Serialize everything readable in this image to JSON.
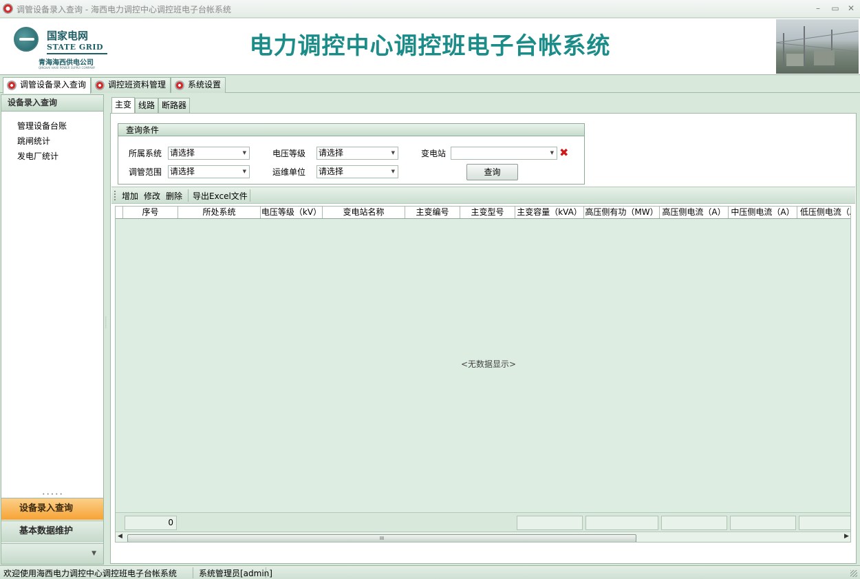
{
  "window": {
    "title": "调管设备录入查询 - 海西电力调控中心调控班电子台帐系统",
    "minimize": "–",
    "maximize": "▭",
    "close": "✕"
  },
  "header": {
    "logo_cn": "国家电网",
    "logo_en": "STATE GRID",
    "logo_company": "青海海西供电公司",
    "logo_company_en": "QINGHAI HAIXI POWER SUPPLY COMPANY",
    "app_title": "电力调控中心调控班电子台帐系统"
  },
  "main_tabs": [
    {
      "label": "调管设备录入查询",
      "active": true
    },
    {
      "label": "调控班资料管理",
      "active": false
    },
    {
      "label": "系统设置",
      "active": false
    }
  ],
  "left_pane": {
    "header": "设备录入查询",
    "items": [
      "管理设备台账",
      "跳闸统计",
      "发电厂统计"
    ],
    "nav_buttons": [
      {
        "label": "设备录入查询",
        "active": true
      },
      {
        "label": "基本数据维护",
        "active": false
      }
    ],
    "more_icon": "chevron-down-icon"
  },
  "sub_tabs": [
    {
      "label": "主变",
      "active": true
    },
    {
      "label": "线路",
      "active": false
    },
    {
      "label": "断路器",
      "active": false
    }
  ],
  "query": {
    "group_title": "查询条件",
    "system_label": "所属系统",
    "system_value": "请选择",
    "voltage_label": "电压等级",
    "voltage_value": "请选择",
    "substation_label": "变电站",
    "substation_value": "",
    "scope_label": "调管范围",
    "scope_value": "请选择",
    "maint_label": "运维单位",
    "maint_value": "请选择",
    "query_button": "查询"
  },
  "toolbar": {
    "add": "增加",
    "edit": "修改",
    "delete": "删除",
    "export": "导出Excel文件"
  },
  "grid": {
    "columns": [
      "序号",
      "所处系统",
      "电压等级（kV）",
      "变电站名称",
      "主变编号",
      "主变型号",
      "主变容量（kVA）",
      "高压侧有功（MW）",
      "高压侧电流（A）",
      "中压侧电流（A）",
      "低压侧电流（A）"
    ],
    "rows": [],
    "empty_text": "<无数据显示>",
    "footer_count": "0",
    "scroll_grip": "III"
  },
  "status": {
    "welcome": "欢迎使用海西电力调控中心调控班电子台帐系统",
    "user": "系统管理员[admin]"
  },
  "colors": {
    "title_teal": "#1b8c88",
    "active_nav": "#f7a334",
    "panel_green": "#d8e9dc",
    "clear_red": "#d01818"
  }
}
